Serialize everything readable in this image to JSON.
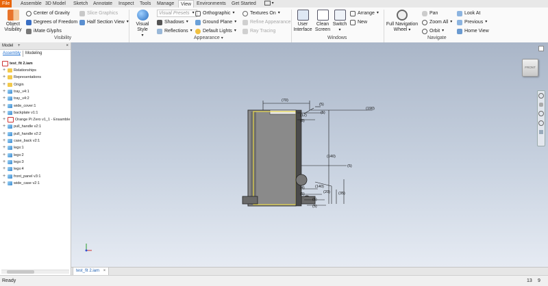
{
  "menu_tabs": [
    {
      "label": "File"
    },
    {
      "label": "Assemble"
    },
    {
      "label": "3D Model"
    },
    {
      "label": "Sketch"
    },
    {
      "label": "Annotate"
    },
    {
      "label": "Inspect"
    },
    {
      "label": "Tools"
    },
    {
      "label": "Manage"
    },
    {
      "label": "View"
    },
    {
      "label": "Environments"
    },
    {
      "label": "Get Started"
    }
  ],
  "ribbon": {
    "visibility": {
      "object_visibility": "Object Visibility",
      "center_of_gravity": "Center of Gravity",
      "degrees_of_freedom": "Degrees of Freedom",
      "imate_glyphs": "iMate Glyphs",
      "slice_graphics": "Slice Graphics",
      "half_section_view": "Half Section View",
      "group": "Visibility"
    },
    "appearance": {
      "visual_style": "Visual Style",
      "visual_presets": "Visual Presets",
      "shadows": "Shadows",
      "reflections": "Reflections",
      "orthographic": "Orthographic",
      "ground_plane": "Ground Plane",
      "default_lights": "Default Lights",
      "textures_on": "Textures On",
      "refine_appearance": "Refine Appearance",
      "ray_tracing": "Ray Tracing",
      "group": "Appearance"
    },
    "windows": {
      "user_interface": "User Interface",
      "clean_screen": "Clean Screen",
      "switch": "Switch",
      "arrange": "Arrange",
      "new": "New",
      "group": "Windows"
    },
    "navigate": {
      "full_navigation_wheel": "Full Navigation Wheel",
      "pan": "Pan",
      "zoom_all": "Zoom All",
      "orbit": "Orbit",
      "look_at": "Look At",
      "previous": "Previous",
      "home_view": "Home View",
      "group": "Navigate"
    }
  },
  "browser": {
    "title": "Model",
    "add": "+",
    "close": "×",
    "tab_assembly": "Assembly",
    "tab_modeling": "Modeling",
    "root": "test_fit 2.iam",
    "items": [
      {
        "label": "Relationships",
        "icon": "folder-icon"
      },
      {
        "label": "Representations",
        "icon": "folder-icon"
      },
      {
        "label": "Origin",
        "icon": "folder-icon"
      },
      {
        "label": "tray_v4:1",
        "icon": "part-icon"
      },
      {
        "label": "tray_v4:2",
        "icon": "part-icon"
      },
      {
        "label": "wide_cover:1",
        "icon": "part-icon"
      },
      {
        "label": "backplate v1:1",
        "icon": "part-icon"
      },
      {
        "label": "Orange Pi Zero v1_1 - Ensamble",
        "icon": "warning-part-icon"
      },
      {
        "label": "pull_handle v2:1",
        "icon": "part-icon"
      },
      {
        "label": "pull_handle v2:2",
        "icon": "part-icon"
      },
      {
        "label": "case_back v2:1",
        "icon": "part-icon"
      },
      {
        "label": "legs:1",
        "icon": "part-icon"
      },
      {
        "label": "legs:2",
        "icon": "part-icon"
      },
      {
        "label": "legs:3",
        "icon": "part-icon"
      },
      {
        "label": "legs:4",
        "icon": "part-icon"
      },
      {
        "label": "front_panel v3:1",
        "icon": "part-icon"
      },
      {
        "label": "wide_case v2:1",
        "icon": "part-icon"
      }
    ]
  },
  "viewport": {
    "viewcube_label": "FRONT",
    "dimensions": [
      "(70)",
      "(5)",
      "(190)",
      "(12)",
      "(8)",
      "(5)",
      "(140)",
      "(5)",
      "(140)",
      "(20)",
      "(35)",
      "(4)",
      "(5)",
      "(5)",
      "(5)"
    ]
  },
  "document_tab": "test_fit 2.iam",
  "document_tab_close": "×",
  "status": {
    "text": "Ready",
    "num1": "13",
    "num2": "9"
  }
}
